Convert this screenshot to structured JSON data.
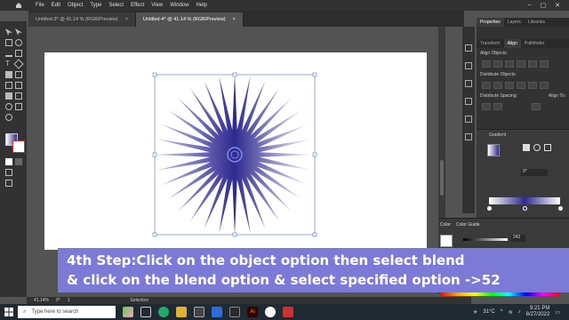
{
  "menubar": {
    "items": [
      "File",
      "Edit",
      "Object",
      "Type",
      "Select",
      "Effect",
      "View",
      "Window",
      "Help"
    ]
  },
  "tabs": [
    {
      "label": "Untitled-3* @ 41.14 % (RGB/Preview)",
      "close": "×"
    },
    {
      "label": "Untitled-4* @ 41.14 % (RGB/Preview)",
      "close": "×"
    }
  ],
  "panel": {
    "top_tabs": [
      "Properties",
      "Layers",
      "Libraries"
    ],
    "sub_tabs": [
      "Transform",
      "Align",
      "Pathfinder"
    ],
    "align_objects": "Align Objects:",
    "distribute_objects": "Distribute Objects:",
    "distribute_spacing": "Distribute Spacing:",
    "align_to": "Align To:",
    "gradient_title": "Gradient",
    "angle": "0°",
    "color_tabs": [
      "Color",
      "Color Guide"
    ],
    "color_value": "242",
    "pathfinder_label": "Pathfind",
    "path_label": "Path",
    "align_label": "Align"
  },
  "status": {
    "zoom": "41.14%",
    "angle": "0°",
    "page": "1",
    "tool": "Selection"
  },
  "caption": {
    "line1": "4th Step:Click on the object option then select blend",
    "line2": "& click on the blend option & select specified option ->52"
  },
  "taskbar": {
    "search_placeholder": "Type here to search",
    "temp": "31°C",
    "time": "9:21 PM",
    "date": "8/27/2022"
  },
  "colors": {
    "accent": "#7b7ad6",
    "gradient_dark": "#2e2a8e"
  }
}
